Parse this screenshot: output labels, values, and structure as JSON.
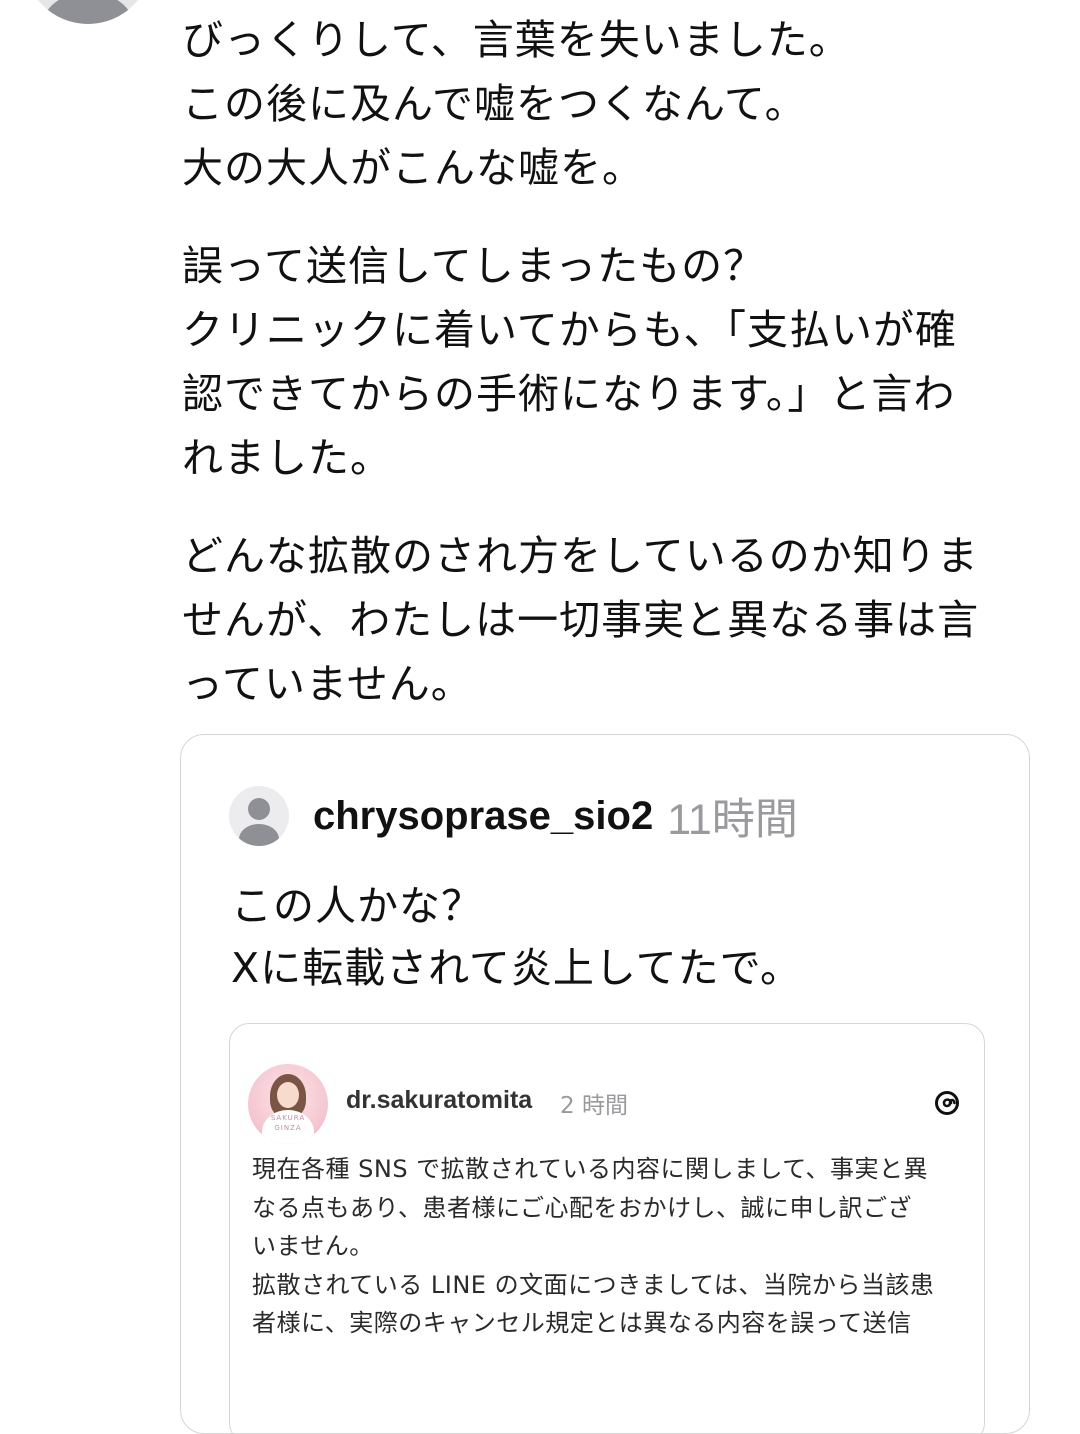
{
  "post": {
    "paragraphs": [
      "びっくりして、言葉を失いました。\nこの後に及んで嘘をつくなんて。\n大の大人がこんな嘘を。",
      "誤って送信してしまったもの？\nクリニックに着いてからも、「支払いが確\n認できてからの手術になります。」と言わ\nれました。",
      "どんな拡散のされ方をしているのか知りま\nせんが、わたしは一切事実と異なる事は言\nっていません。"
    ]
  },
  "quote": {
    "username": "chrysoprase_sio2",
    "time": "11時間",
    "text": "この人かな？\nXに転載されて炎上してたで。",
    "embedded": {
      "username": "dr.sakuratomita",
      "time": "2 時間",
      "avatar_mark_top": "SAKURA",
      "avatar_mark_bottom": "GINZA",
      "app_icon": "threads-icon",
      "paragraphs": [
        "現在各種 SNS で拡散されている内容に関しまして、事実と異\nなる点もあり、患者様にご心配をおかけし、誠に申し訳ござ\nいません。",
        "拡散されている LINE の文面につきましては、当院から当該患\n者様に、実際のキャンセル規定とは異なる内容を誤って送信"
      ]
    }
  }
}
